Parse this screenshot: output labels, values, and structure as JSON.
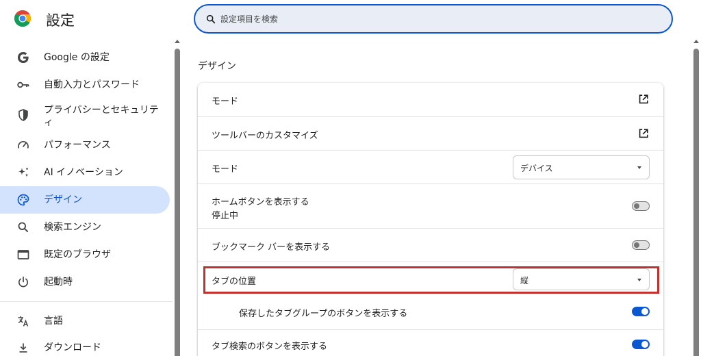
{
  "app": {
    "title": "設定"
  },
  "search": {
    "placeholder": "設定項目を検索"
  },
  "sidebar": {
    "items": [
      {
        "label": "Google の設定",
        "icon": "google-g-icon",
        "active": false
      },
      {
        "label": "自動入力とパスワード",
        "icon": "key-icon",
        "active": false
      },
      {
        "label": "プライバシーとセキュリティ",
        "icon": "shield-icon",
        "active": false
      },
      {
        "label": "パフォーマンス",
        "icon": "speedometer-icon",
        "active": false
      },
      {
        "label": "AI イノベーション",
        "icon": "sparkle-icon",
        "active": false
      },
      {
        "label": "デザイン",
        "icon": "palette-icon",
        "active": true
      },
      {
        "label": "検索エンジン",
        "icon": "search-icon",
        "active": false
      },
      {
        "label": "既定のブラウザ",
        "icon": "browser-window-icon",
        "active": false
      },
      {
        "label": "起動時",
        "icon": "power-icon",
        "active": false
      },
      {
        "label": "言語",
        "icon": "translate-icon",
        "active": false
      },
      {
        "label": "ダウンロード",
        "icon": "download-icon",
        "active": false
      }
    ]
  },
  "main": {
    "section_title": "デザイン",
    "rows": [
      {
        "label": "モード",
        "control": "external-link"
      },
      {
        "label": "ツールバーのカスタマイズ",
        "control": "external-link"
      },
      {
        "label": "モード",
        "control": "select",
        "value": "デバイス"
      },
      {
        "label": "ホームボタンを表示する",
        "sublabel": "停止中",
        "control": "toggle",
        "checked": false
      },
      {
        "label": "ブックマーク バーを表示する",
        "control": "toggle",
        "checked": false
      },
      {
        "label": "タブの位置",
        "control": "select",
        "value": "縦",
        "highlighted": true
      },
      {
        "label": "保存したタブグループのボタンを表示する",
        "control": "toggle",
        "checked": true,
        "indented": true
      },
      {
        "label": "タブ検索のボタンを表示する",
        "control": "toggle",
        "checked": true
      }
    ]
  },
  "colors": {
    "accent": "#0b57d0",
    "active_nav_bg": "#d3e3fd",
    "search_bg": "#e9eef6",
    "highlight_border": "#c2312c"
  }
}
